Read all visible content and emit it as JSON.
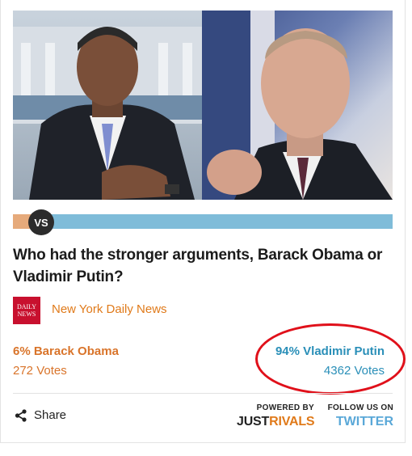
{
  "poll": {
    "vs_label": "VS",
    "question": "Who had the stronger arguments, Barack Obama or Vladimir Putin?",
    "source": {
      "logo_line1": "DAILY",
      "logo_line2": "NEWS",
      "name": "New York Daily News"
    },
    "left": {
      "result": "6% Barack Obama",
      "votes": "272 Votes",
      "share_fraction": 0.06,
      "color": "#d9742a"
    },
    "right": {
      "result": "94% Vladimir Putin",
      "votes": "4362 Votes",
      "share_fraction": 0.94,
      "color": "#2a8fb8"
    }
  },
  "footer": {
    "share_label": "Share",
    "powered_by_label": "POWERED BY",
    "brand_part1": "JUST",
    "brand_part2": "RIVALS",
    "follow_label": "FOLLOW US ON",
    "follow_link": "TWITTER"
  },
  "colors": {
    "accent_orange": "#e07a1a",
    "accent_blue": "#2a8fb8",
    "highlight_circle": "#e0101a"
  }
}
